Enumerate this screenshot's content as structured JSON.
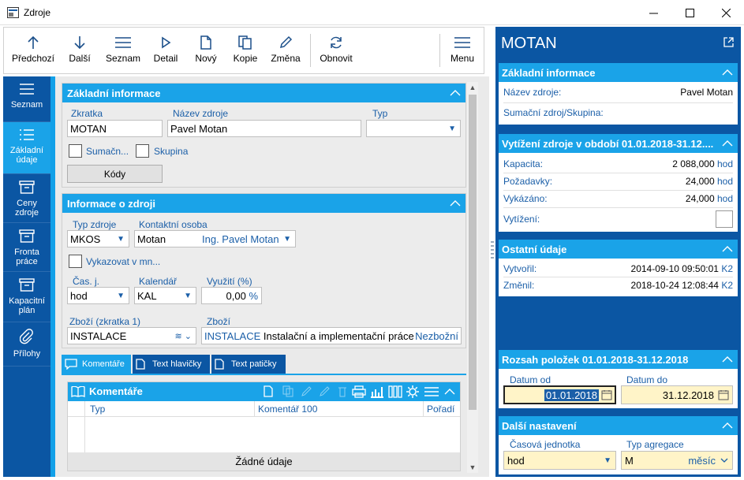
{
  "window": {
    "title": "Zdroje"
  },
  "toolbar": {
    "items": [
      "Předchozí",
      "Další",
      "Seznam",
      "Detail",
      "Nový",
      "Kopie",
      "Změna",
      "Obnovit",
      "Menu"
    ]
  },
  "leftnav": {
    "items": [
      "Seznam",
      "Základní údaje",
      "Ceny zdroje",
      "Fronta práce",
      "Kapacitní plán",
      "Přílohy"
    ]
  },
  "basic": {
    "title": "Základní informace",
    "zkratka_label": "Zkratka",
    "zkratka_value": "MOTAN",
    "nazev_label": "Název zdroje",
    "nazev_value": "Pavel Motan",
    "typ_label": "Typ",
    "sumac_label": "Sumačn...",
    "skupina_label": "Skupina",
    "kody_button": "Kódy"
  },
  "info": {
    "title": "Informace o zdroji",
    "typ_zdroje_label": "Typ zdroje",
    "typ_zdroje_value": "MKOS",
    "kontakt_label": "Kontaktní osoba",
    "kontakt_value": "Motan",
    "kontakt_name": "Ing. Pavel Motan",
    "vykazovat_label": "Vykazovat v mn...",
    "casj_label": "Čas. j.",
    "casj_value": "hod",
    "kalendar_label": "Kalendář",
    "kalendar_value": "KAL",
    "vyuziti_label": "Využití (%)",
    "vyuziti_value": "0,00",
    "vyuziti_unit": "%",
    "zbozi1_label": "Zboží (zkratka 1)",
    "zbozi1_value": "INSTALACE",
    "zbozi_label": "Zboží",
    "zbozi_code": "INSTALACE",
    "zbozi_name": "Instalační a implementační práce",
    "zbozi_type": "Nezbožní"
  },
  "tabs": [
    "Komentáře",
    "Text hlavičky",
    "Text patičky"
  ],
  "comments": {
    "title": "Komentáře",
    "columns": [
      "Typ",
      "Komentář 100",
      "Pořadí"
    ],
    "empty_text": "Žádné údaje"
  },
  "right": {
    "title": "MOTAN",
    "basic_title": "Základní informace",
    "nazev_label": "Název zdroje:",
    "nazev_value": "Pavel Motan",
    "sumac_label": "Sumační zdroj/Skupina:",
    "vytizeni_title": "Vytížení zdroje v období 01.01.2018-31.12....",
    "kapacita_label": "Kapacita:",
    "kapacita_value": "2 088,000",
    "pozadavky_label": "Požadavky:",
    "pozadavky_value": "24,000",
    "vykazano_label": "Vykázáno:",
    "vykazano_value": "24,000",
    "unit": "hod",
    "vytizeni_label": "Vytížení:",
    "ostatni_title": "Ostatní údaje",
    "vytvoril_label": "Vytvořil:",
    "vytvoril_value": "2014-09-10 09:50:01",
    "vytvoril_user": "K2",
    "zmenil_label": "Změnil:",
    "zmenil_value": "2018-10-24 12:08:44",
    "zmenil_user": "K2",
    "rozsah_title": "Rozsah položek 01.01.2018-31.12.2018",
    "datum_od_label": "Datum od",
    "datum_od_value": "01.01.2018",
    "datum_do_label": "Datum do",
    "datum_do_value": "31.12.2018",
    "dalsi_title": "Další nastavení",
    "cas_jed_label": "Časová jednotka",
    "cas_jed_value": "hod",
    "typ_agr_label": "Typ agregace",
    "typ_agr_value": "M",
    "typ_agr_text": "měsíc"
  }
}
